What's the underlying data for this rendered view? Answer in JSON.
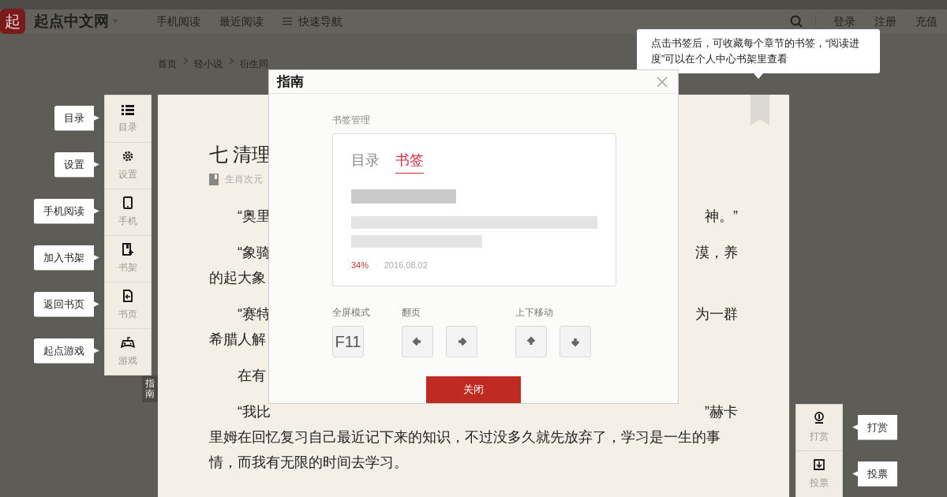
{
  "header": {
    "logo": "起",
    "site_name": "起点中文网",
    "nav": [
      {
        "label": "手机阅读",
        "menu": false
      },
      {
        "label": "最近阅读",
        "menu": false
      },
      {
        "label": "快速导航",
        "menu": true
      }
    ],
    "user_links": [
      "登录",
      "注册",
      "充值"
    ]
  },
  "breadcrumb": [
    "首页",
    "轻小说",
    "衍生同"
  ],
  "left_toolbar": [
    {
      "label": "目录",
      "tip": "目录"
    },
    {
      "label": "设置",
      "tip": "设置"
    },
    {
      "label": "手机",
      "tip": "手机阅读"
    },
    {
      "label": "书架",
      "tip": "加入书架"
    },
    {
      "label": "书页",
      "tip": "返回书页"
    },
    {
      "label": "游戏",
      "tip": "起点游戏"
    }
  ],
  "guide_tab": "指南",
  "chapter": {
    "title": "七 清理",
    "book": "生肖次元"
  },
  "lines": [
    {
      "kind": "first",
      "left": "“奥里",
      "right": "神。”"
    },
    {
      "kind": "first",
      "left": "“象骑",
      "right": "漠，养"
    },
    {
      "kind": "cont",
      "left": "的起大象"
    },
    {
      "kind": "first",
      "left": "“赛特",
      "right": "为一群"
    },
    {
      "kind": "cont",
      "left": "希腊人解"
    },
    {
      "kind": "first",
      "left": "在有"
    },
    {
      "kind": "first",
      "left": "“我比",
      "right": "”赫卡"
    },
    {
      "kind": "cont",
      "left": "里姆在回忆复习自己最近记下来的知识，不过没多久就先放弃了，学习是一生的事"
    },
    {
      "kind": "cont",
      "left": "情，而我有无限的时间去学习。"
    }
  ],
  "right_toolbar": [
    {
      "label": "打赏",
      "tip": "打赏"
    },
    {
      "label": "投票",
      "tip": "投票"
    }
  ],
  "bookmark_tip": "点击书签后，可收藏每个章节的书签，“阅读进度”可以在个人中心书架里查看",
  "modal": {
    "title": "指南",
    "section_label": "书签管理",
    "tabs": [
      {
        "label": "目录",
        "selected": false
      },
      {
        "label": "书签",
        "selected": true
      }
    ],
    "progress": "34%",
    "separator": "·",
    "date": "2016.08.02",
    "shortcuts": [
      {
        "label": "全屏模式",
        "keys": [
          {
            "kind": "text",
            "label": "F11"
          }
        ]
      },
      {
        "label": "翻页",
        "keys": [
          {
            "kind": "left"
          },
          {
            "kind": "right"
          }
        ]
      },
      {
        "label": "上下移动",
        "keys": [
          {
            "kind": "up"
          },
          {
            "kind": "down"
          }
        ]
      }
    ],
    "close_button": "关闭"
  }
}
